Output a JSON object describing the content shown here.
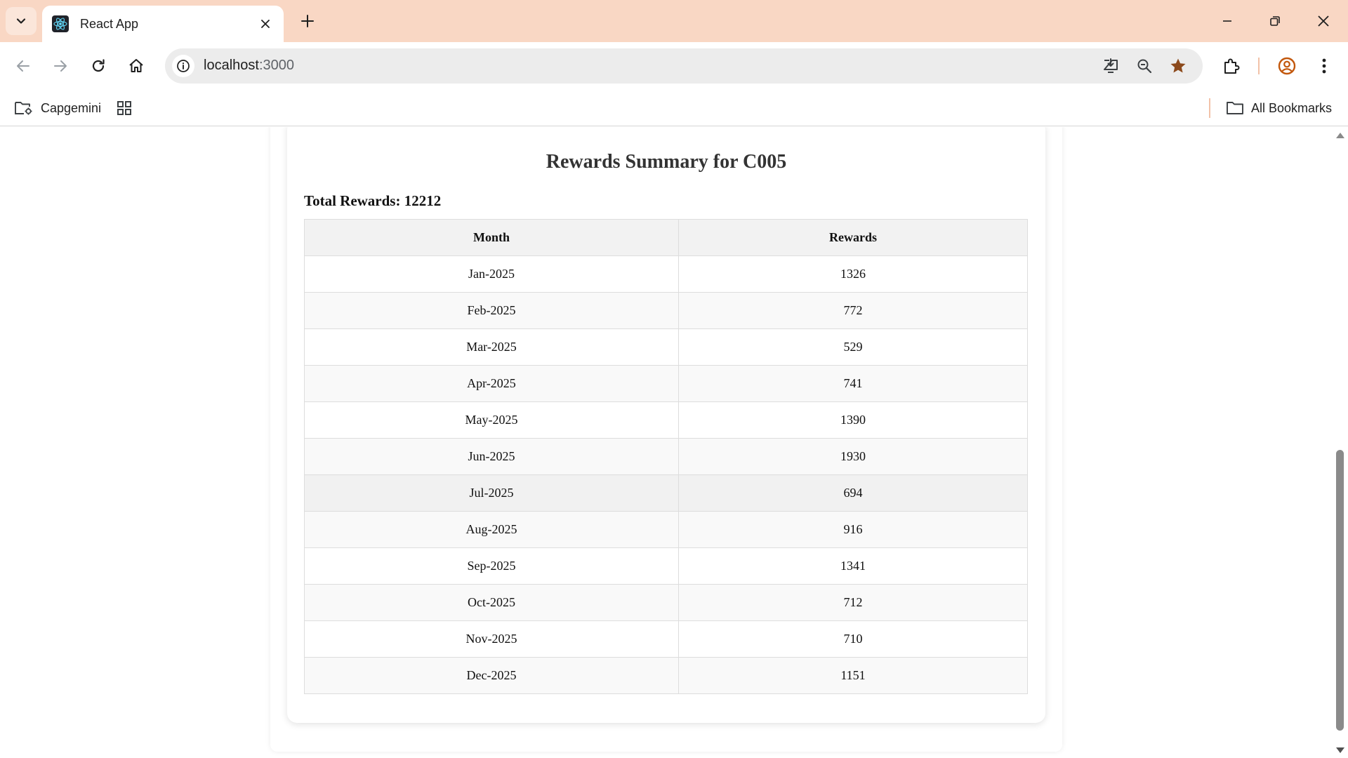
{
  "browser": {
    "tab": {
      "title": "React App",
      "favicon": "react-logo-icon"
    },
    "address": {
      "host": "localhost",
      "port": ":3000"
    },
    "bookmarks": {
      "folder_label": "Capgemini",
      "all_label": "All Bookmarks"
    },
    "accent_color": "#f9d7c4",
    "icons": [
      "tab-search-icon",
      "close-icon",
      "new-tab-icon",
      "minimize-icon",
      "restore-icon",
      "window-close-icon",
      "back-icon",
      "forward-icon",
      "reload-icon",
      "home-icon",
      "site-info-icon",
      "install-app-icon",
      "zoom-icon",
      "bookmark-star-icon",
      "extensions-icon",
      "profile-icon",
      "menu-icon",
      "apps-grid-icon",
      "folder-icon"
    ]
  },
  "summary": {
    "title": "Rewards Summary for C005",
    "total_label": "Total Rewards: 12212",
    "columns": [
      "Month",
      "Rewards"
    ],
    "rows": [
      {
        "month": "Jan-2025",
        "rewards": "1326"
      },
      {
        "month": "Feb-2025",
        "rewards": "772"
      },
      {
        "month": "Mar-2025",
        "rewards": "529"
      },
      {
        "month": "Apr-2025",
        "rewards": "741"
      },
      {
        "month": "May-2025",
        "rewards": "1390"
      },
      {
        "month": "Jun-2025",
        "rewards": "1930"
      },
      {
        "month": "Jul-2025",
        "rewards": "694"
      },
      {
        "month": "Aug-2025",
        "rewards": "916"
      },
      {
        "month": "Sep-2025",
        "rewards": "1341"
      },
      {
        "month": "Oct-2025",
        "rewards": "712"
      },
      {
        "month": "Nov-2025",
        "rewards": "710"
      },
      {
        "month": "Dec-2025",
        "rewards": "1151"
      }
    ]
  }
}
